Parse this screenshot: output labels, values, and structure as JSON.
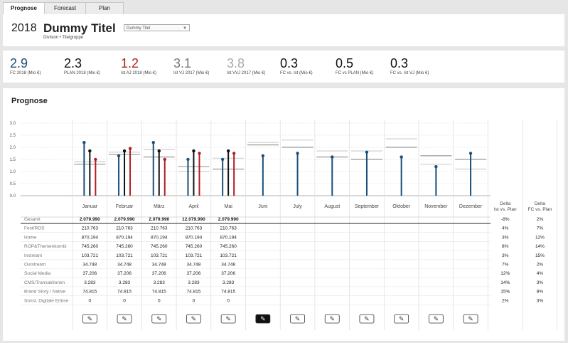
{
  "tabs": [
    {
      "label": "Prognose",
      "active": true
    },
    {
      "label": "Forecast",
      "active": false
    },
    {
      "label": "Plan",
      "active": false
    }
  ],
  "header": {
    "year": "2018",
    "title": "Dummy Titel",
    "subtitle": "Division • Titelgruppe",
    "dropdown_value": "Dummy Titel"
  },
  "kpis": [
    {
      "value": "2.9",
      "label": "FC 2018 (Mio €)",
      "color": "#1a4f7a"
    },
    {
      "value": "2.3",
      "label": "PLAN 2018 (Mio €)",
      "color": "#111111"
    },
    {
      "value": "1.2",
      "label": "Ist AJ 2018 (Mio €)",
      "color": "#b01e23"
    },
    {
      "value": "3.1",
      "label": "Ist VJ 2017 (Mio €)",
      "color": "#777777"
    },
    {
      "value": "3.8",
      "label": "Ist VVJ 2017 (Mio €)",
      "color": "#aaaaaa"
    },
    {
      "value": "0.3",
      "label": "FC vs. Ist (Mio €)",
      "color": "#111111"
    },
    {
      "value": "0.5",
      "label": "FC vs PLAN (Mio €)",
      "color": "#111111"
    },
    {
      "value": "0.3",
      "label": "FC vs. Ist VJ (Mio €)",
      "color": "#111111"
    }
  ],
  "section_title": "Prognose",
  "colors": {
    "fc": "#1a4f7a",
    "plan": "#111111",
    "ist": "#b01e23",
    "vj": "#9a9a9a",
    "vvj": "#cfcfcf"
  },
  "chart_data": {
    "type": "bar",
    "ylim": [
      0,
      3.0
    ],
    "yticks": [
      "0.0",
      "0.5",
      "1.0",
      "1.5",
      "2.0",
      "2.5",
      "3.0"
    ],
    "categories": [
      "Januar",
      "Februar",
      "März",
      "April",
      "Mai",
      "Juni",
      "July",
      "August",
      "September",
      "Oktober",
      "November",
      "Dezember"
    ],
    "series": [
      {
        "key": "fc",
        "values": [
          2.2,
          1.65,
          2.2,
          1.5,
          1.5,
          1.65,
          1.75,
          1.6,
          1.8,
          1.6,
          1.2,
          1.75
        ]
      },
      {
        "key": "plan",
        "values": [
          1.85,
          1.85,
          1.85,
          1.85,
          1.85,
          null,
          null,
          null,
          null,
          null,
          null,
          null
        ]
      },
      {
        "key": "ist",
        "values": [
          1.5,
          1.95,
          1.5,
          1.75,
          1.75,
          null,
          null,
          null,
          null,
          null,
          null,
          null
        ]
      },
      {
        "key": "vj",
        "values": [
          1.3,
          1.7,
          1.6,
          1.2,
          1.1,
          2.1,
          2.0,
          1.6,
          1.5,
          2.0,
          1.65,
          1.5
        ]
      },
      {
        "key": "vvj",
        "values": [
          1.4,
          1.8,
          1.9,
          1.0,
          1.55,
          2.2,
          2.3,
          1.85,
          1.85,
          2.35,
          1.3,
          1.1
        ]
      }
    ]
  },
  "table": {
    "delta_headers": [
      [
        "Delta",
        "Ist vs. Plan"
      ],
      [
        "Delta",
        "FC vs. Plan"
      ]
    ],
    "rows": [
      {
        "label": "Gesamt",
        "values": [
          "2.079.990",
          "2.079.990",
          "2.079.990",
          "12.079.990",
          "2.079.990"
        ],
        "d1": "-8%",
        "d2": "2%",
        "bold": true
      },
      {
        "label": "Fest/ROS",
        "values": [
          "210.763",
          "210.763",
          "210.763",
          "210.763",
          "210.763"
        ],
        "d1": "4%",
        "d2": "7%"
      },
      {
        "label": "Home",
        "values": [
          "870.194",
          "870.194",
          "870.194",
          "870.194",
          "870.194"
        ],
        "d1": "3%",
        "d2": "12%"
      },
      {
        "label": "ROP&Themenkombi",
        "values": [
          "745.260",
          "745.260",
          "745.260",
          "745.260",
          "745.260"
        ],
        "d1": "8%",
        "d2": "14%"
      },
      {
        "label": "Instream",
        "values": [
          "103.721",
          "103.721",
          "103.721",
          "103.721",
          "103.721"
        ],
        "d1": "3%",
        "d2": "15%"
      },
      {
        "label": "Outstream",
        "values": [
          "34.748",
          "34.748",
          "34.748",
          "34.748",
          "34.748"
        ],
        "d1": "7%",
        "d2": "2%"
      },
      {
        "label": "Social Media",
        "values": [
          "37.206",
          "37.206",
          "37.206",
          "37.206",
          "37.206"
        ],
        "d1": "12%",
        "d2": "4%"
      },
      {
        "label": "CMS/Transaktionen",
        "values": [
          "3.283",
          "3.283",
          "3.283",
          "3.283",
          "3.283"
        ],
        "d1": "14%",
        "d2": "3%"
      },
      {
        "label": "Brand Story / Native",
        "values": [
          "74.815",
          "74.815",
          "74.815",
          "74.815",
          "74.815"
        ],
        "d1": "15%",
        "d2": "8%"
      },
      {
        "label": "Sonst. Digitale Erlöse",
        "values": [
          "0",
          "0",
          "0",
          "0",
          "0"
        ],
        "d1": "2%",
        "d2": "3%"
      }
    ],
    "edit_active_index": 5
  }
}
